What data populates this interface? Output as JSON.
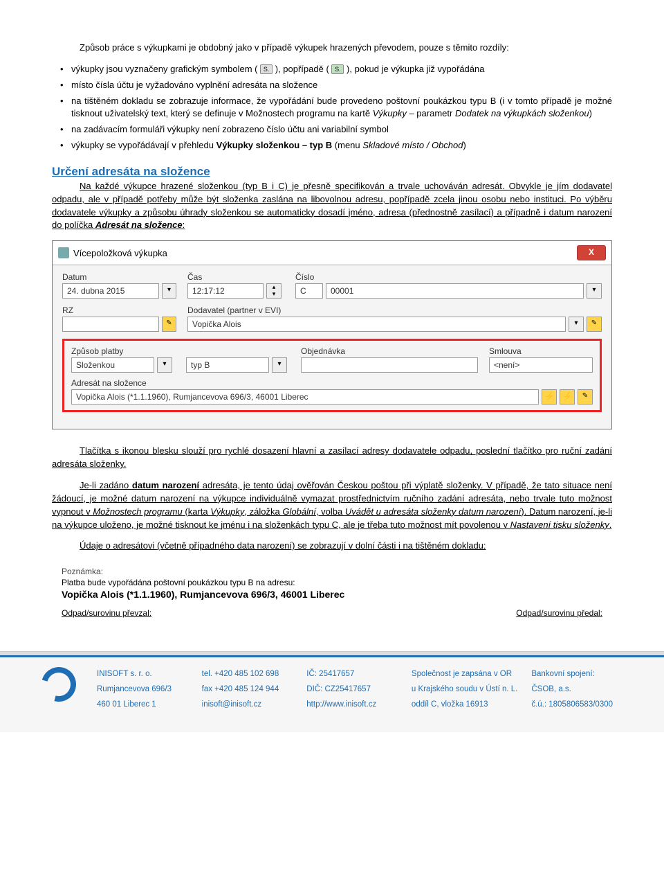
{
  "p1a": "Způsob práce s výkupkami je obdobný jako v případě výkupek hrazených převodem, pouze s těmito rozdíly:",
  "b1a": "výkupky jsou vyznačeny grafickým symbolem (",
  "b1b": "), popřípadě (",
  "b1c": "), pokud je výkupka již vypořádána",
  "icon_s": "S.",
  "b2": "místo čísla účtu je vyžadováno vyplnění adresáta na složence",
  "b3a": "na tištěném dokladu se zobrazuje informace, že vypořádání bude provedeno poštovní poukázkou typu B (i v tomto případě je možné tisknout uživatelský text, který se definuje v Možnostech programu na kartě ",
  "b3b": "Výkupky",
  "b3c": " – parametr ",
  "b3d": "Dodatek na výkupkách složenkou",
  "b3e": ")",
  "b4": "na zadávacím formuláři výkupky není zobrazeno číslo účtu ani variabilní symbol",
  "b5a": "výkupky se vypořádávají v přehledu ",
  "b5b": "Výkupky složenkou – typ B",
  "b5c": " (menu ",
  "b5d": "Skladové místo / Obchod",
  "b5e": ")",
  "h1": "Určení adresáta na složence",
  "p2a": "Na každé výkupce hrazené složenkou (typ B i C) je přesně specifikován a trvale uchováván adresát. Obvykle je jím dodavatel odpadu, ale v případě potřeby může být složenka zaslána na libovolnou adresu, popřípadě zcela jinou osobu nebo instituci. Po výběru dodavatele výkupky a způsobu úhrady složenkou se automaticky dosadí jméno, adresa (přednostně zasílací) a případně i datum narození do políčka ",
  "p2b": "Adresát na složence",
  "p2c": ":",
  "dlg": {
    "title": "Vícepoložková výkupka",
    "close": "X",
    "datum_lbl": "Datum",
    "datum_val": "24. dubna 2015",
    "cas_lbl": "Čas",
    "cas_val": "12:17:12",
    "cislo_lbl": "Číslo",
    "cislo_prefix": "C",
    "cislo_val": "00001",
    "rz_lbl": "RZ",
    "rz_val": "",
    "dodav_lbl": "Dodavatel (partner v EVI)",
    "dodav_val": "Vopička Alois",
    "zpusob_lbl": "Způsob platby",
    "zpusob_val": "Složenkou",
    "typ_val": "typ B",
    "obj_lbl": "Objednávka",
    "obj_val": "",
    "sml_lbl": "Smlouva",
    "sml_val": "<není>",
    "adresat_lbl": "Adresát na složence",
    "adresat_val": "Vopička Alois (*1.1.1960), Rumjancevova 696/3, 46001 Liberec"
  },
  "p3": "Tlačítka s ikonou blesku slouží pro rychlé dosazení hlavní a zasílací adresy dodavatele odpadu, poslední tlačítko pro ruční zadání adresáta složenky.",
  "p4a": "Je-li zadáno ",
  "p4b": "datum narození",
  "p4c": " adresáta, je tento údaj ověřován Českou poštou při výplatě složenky. V případě, že tato situace není žádoucí, je možné datum narození na výkupce individuálně vymazat prostřednictvím ručního zadání adresáta, nebo trvale tuto možnost vypnout v ",
  "p4d": "Možnostech programu",
  "p4e": " (karta ",
  "p4f": "Výkupky",
  "p4g": ", záložka ",
  "p4h": "Globální",
  "p4i": ", volba ",
  "p4j": "Uvádět u adresáta složenky datum narození",
  "p4k": "). Datum narození, je-li na výkupce uloženo, je možné tisknout ke jménu i na složenkách typu C, ale je třeba tuto možnost mít povolenou v ",
  "p4l": "Nastavení tisku složenky",
  "p4m": ".",
  "p5": "Údaje o adresátovi (včetně případného data narození) se zobrazují v dolní části i na tištěném dokladu:",
  "printed": {
    "pozn": "Poznámka:",
    "l1": "Platba bude vypořádána poštovní poukázkou typu B na adresu:",
    "l2": "Vopička Alois (*1.1.1960), Rumjancevova 696/3, 46001 Liberec",
    "s1": "Odpad/surovinu převzal:",
    "s2": "Odpad/surovinu předal:"
  },
  "footer": {
    "c1a": "INISOFT s. r. o.",
    "c1b": "Rumjancevova 696/3",
    "c1c": "460 01 Liberec 1",
    "c2a": "tel. +420 485 102 698",
    "c2b": "fax +420 485 124 944",
    "c2c": "inisoft@inisoft.cz",
    "c3a": "IČ: 25417657",
    "c3b": "DIČ: CZ25417657",
    "c3c": "http://www.inisoft.cz",
    "c4a": "Společnost je zapsána v OR",
    "c4b": "u Krajského soudu v Ústí n. L.",
    "c4c": "oddíl C, vložka 16913",
    "c5a": "Bankovní spojení:",
    "c5b": "ČSOB, a.s.",
    "c5c": "č.ú.: 1805806583/0300"
  }
}
